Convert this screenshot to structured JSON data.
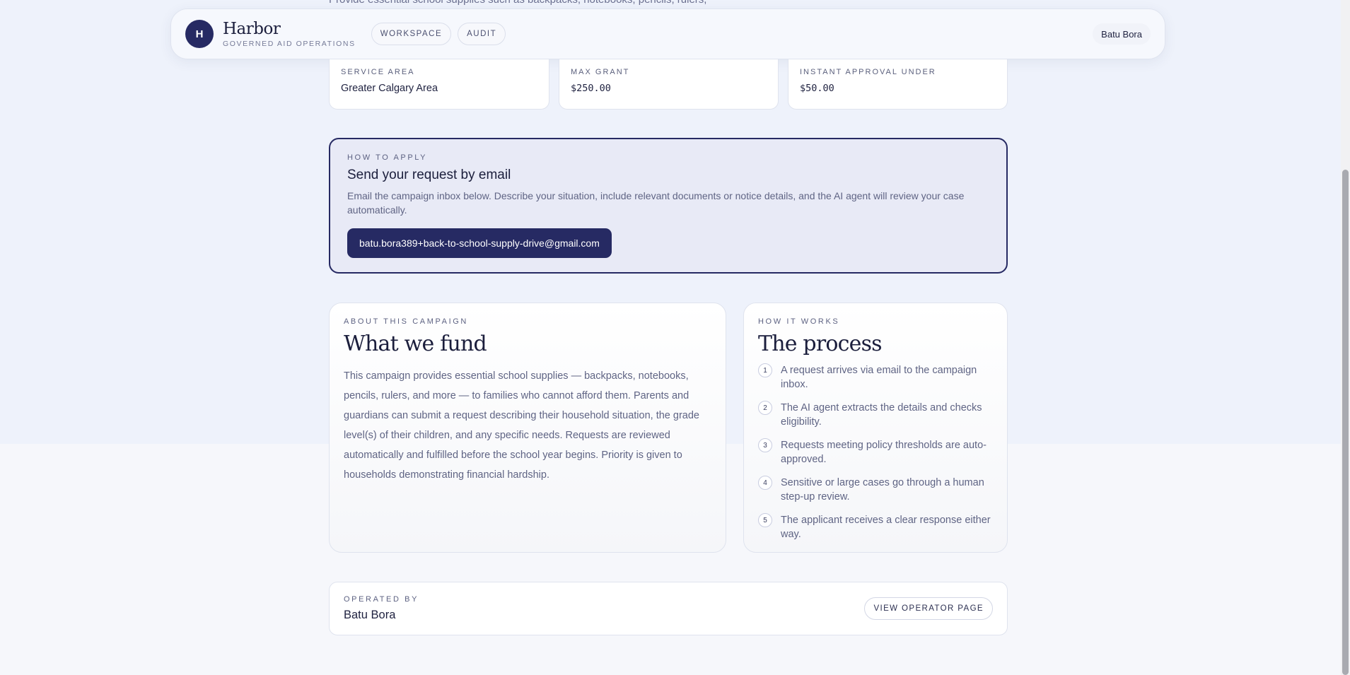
{
  "top_cut_text": "Provide essential school supplies such as backpacks, notebooks, pencils, rulers,",
  "header": {
    "logo_letter": "H",
    "brand": "Harbor",
    "subtitle": "GOVERNED AID OPERATIONS",
    "nav": [
      "WORKSPACE",
      "AUDIT"
    ],
    "user": "Batu Bora"
  },
  "stats": [
    {
      "label": "SERVICE AREA",
      "value": "Greater Calgary Area"
    },
    {
      "label": "MAX GRANT",
      "value": "$250.00"
    },
    {
      "label": "INSTANT APPROVAL UNDER",
      "value": "$50.00"
    }
  ],
  "apply": {
    "eyebrow": "HOW TO APPLY",
    "title": "Send your request by email",
    "description": "Email the campaign inbox below. Describe your situation, include relevant documents or notice details, and the AI agent will review your case automatically.",
    "email": "batu.bora389+back-to-school-supply-drive@gmail.com"
  },
  "about": {
    "eyebrow": "ABOUT THIS CAMPAIGN",
    "title": "What we fund",
    "body": "This campaign provides essential school supplies — backpacks, notebooks, pencils, rulers, and more — to families who cannot afford them. Parents and guardians can submit a request describing their household situation, the grade level(s) of their children, and any specific needs. Requests are reviewed automatically and fulfilled before the school year begins. Priority is given to households demonstrating financial hardship."
  },
  "process": {
    "eyebrow": "HOW IT WORKS",
    "title": "The process",
    "steps": [
      {
        "num": "1",
        "text": "A request arrives via email to the campaign inbox."
      },
      {
        "num": "2",
        "text": "The AI agent extracts the details and checks eligibility."
      },
      {
        "num": "3",
        "text": "Requests meeting policy thresholds are auto-approved."
      },
      {
        "num": "4",
        "text": "Sensitive or large cases go through a human step-up review."
      },
      {
        "num": "5",
        "text": "The applicant receives a clear response either way."
      }
    ]
  },
  "operator": {
    "eyebrow": "OPERATED BY",
    "name": "Batu Bora",
    "button": "VIEW OPERATOR PAGE"
  },
  "colors": {
    "accent": "#262a63",
    "page_bg": "#eef2fb"
  }
}
